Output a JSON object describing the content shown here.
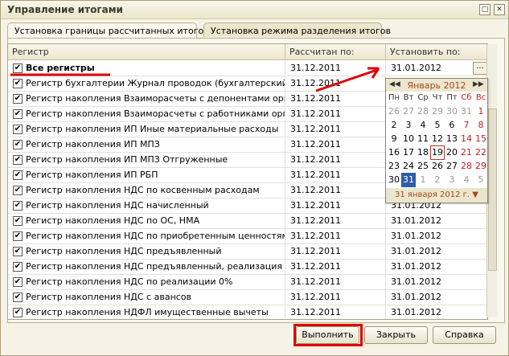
{
  "window": {
    "title": "Управление итогами",
    "min_glyph": "□",
    "close_glyph": "✕"
  },
  "tabs": [
    {
      "label": "Установка границы рассчитанных итогов"
    },
    {
      "label": "Установка режима разделения итогов"
    }
  ],
  "grid": {
    "headers": [
      "Регистр",
      "Рассчитан по:",
      "Установить по:"
    ],
    "rows": [
      {
        "name": "Все регистры",
        "calc": "31.12.2011",
        "set": "31.01.2012"
      },
      {
        "name": "Регистр бухгалтерии Журнал проводок (бухгалтерский и н...",
        "calc": "31.12.2011",
        "set": ""
      },
      {
        "name": "Регистр накопления Взаиморасчеты с депонентами орган...",
        "calc": "31.12.2011",
        "set": ""
      },
      {
        "name": "Регистр накопления Взаиморасчеты с работниками орган...",
        "calc": "31.12.2011",
        "set": ""
      },
      {
        "name": "Регистр накопления ИП Иные материальные расходы",
        "calc": "31.12.2011",
        "set": ""
      },
      {
        "name": "Регистр накопления ИП МПЗ",
        "calc": "31.12.2011",
        "set": ""
      },
      {
        "name": "Регистр накопления ИП МПЗ Отгруженные",
        "calc": "31.12.2011",
        "set": ""
      },
      {
        "name": "Регистр накопления ИП РБП",
        "calc": "31.12.2011",
        "set": ""
      },
      {
        "name": "Регистр накопления НДС по косвенным расходам",
        "calc": "31.12.2011",
        "set": "31.01.2012"
      },
      {
        "name": "Регистр накопления НДС начисленный",
        "calc": "31.12.2011",
        "set": "31.01.2012"
      },
      {
        "name": "Регистр накопления НДС по ОС, НМА",
        "calc": "31.12.2011",
        "set": "31.01.2012"
      },
      {
        "name": "Регистр накопления НДС по приобретенным ценностям",
        "calc": "31.12.2011",
        "set": "31.01.2012"
      },
      {
        "name": "Регистр накопления НДС предъявленный",
        "calc": "31.12.2011",
        "set": "31.01.2012"
      },
      {
        "name": "Регистр накопления НДС предъявленный, реализация 0%",
        "calc": "31.12.2011",
        "set": "31.01.2012"
      },
      {
        "name": "Регистр накопления НДС по реализации 0%",
        "calc": "31.12.2011",
        "set": "31.01.2012"
      },
      {
        "name": "Регистр накопления НДС с авансов",
        "calc": "31.12.2011",
        "set": "31.01.2012"
      },
      {
        "name": "Регистр накопления НДФЛ имущественные вычеты",
        "calc": "31.12.2011",
        "set": "31.01.2012"
      }
    ],
    "check_glyph": "✔",
    "ellipsis": "..."
  },
  "calendar": {
    "month_label": "Январь 2012",
    "prev_glyph": "◀◀",
    "next_glyph": "▶▶",
    "weekdays": [
      "Пн",
      "Вт",
      "Ср",
      "Чт",
      "Пт",
      "Сб",
      "Вс"
    ],
    "weeks": [
      [
        "26",
        "27",
        "28",
        "29",
        "30",
        "31",
        "1"
      ],
      [
        "2",
        "3",
        "4",
        "5",
        "6",
        "7",
        "8"
      ],
      [
        "9",
        "10",
        "11",
        "12",
        "13",
        "14",
        "15"
      ],
      [
        "16",
        "17",
        "18",
        "19",
        "20",
        "21",
        "22"
      ],
      [
        "23",
        "24",
        "25",
        "26",
        "27",
        "28",
        "29"
      ],
      [
        "30",
        "31",
        "1",
        "2",
        "3",
        "4",
        "5"
      ]
    ],
    "footer": "31 января 2012 г.",
    "footer_glyph": "▼"
  },
  "buttons": {
    "execute": "Выполнить",
    "close": "Закрыть",
    "help": "Справка"
  },
  "colors": {
    "highlight": "#e00000",
    "selected_day": "#2f5ea8",
    "weekend": "#c71b1b"
  }
}
